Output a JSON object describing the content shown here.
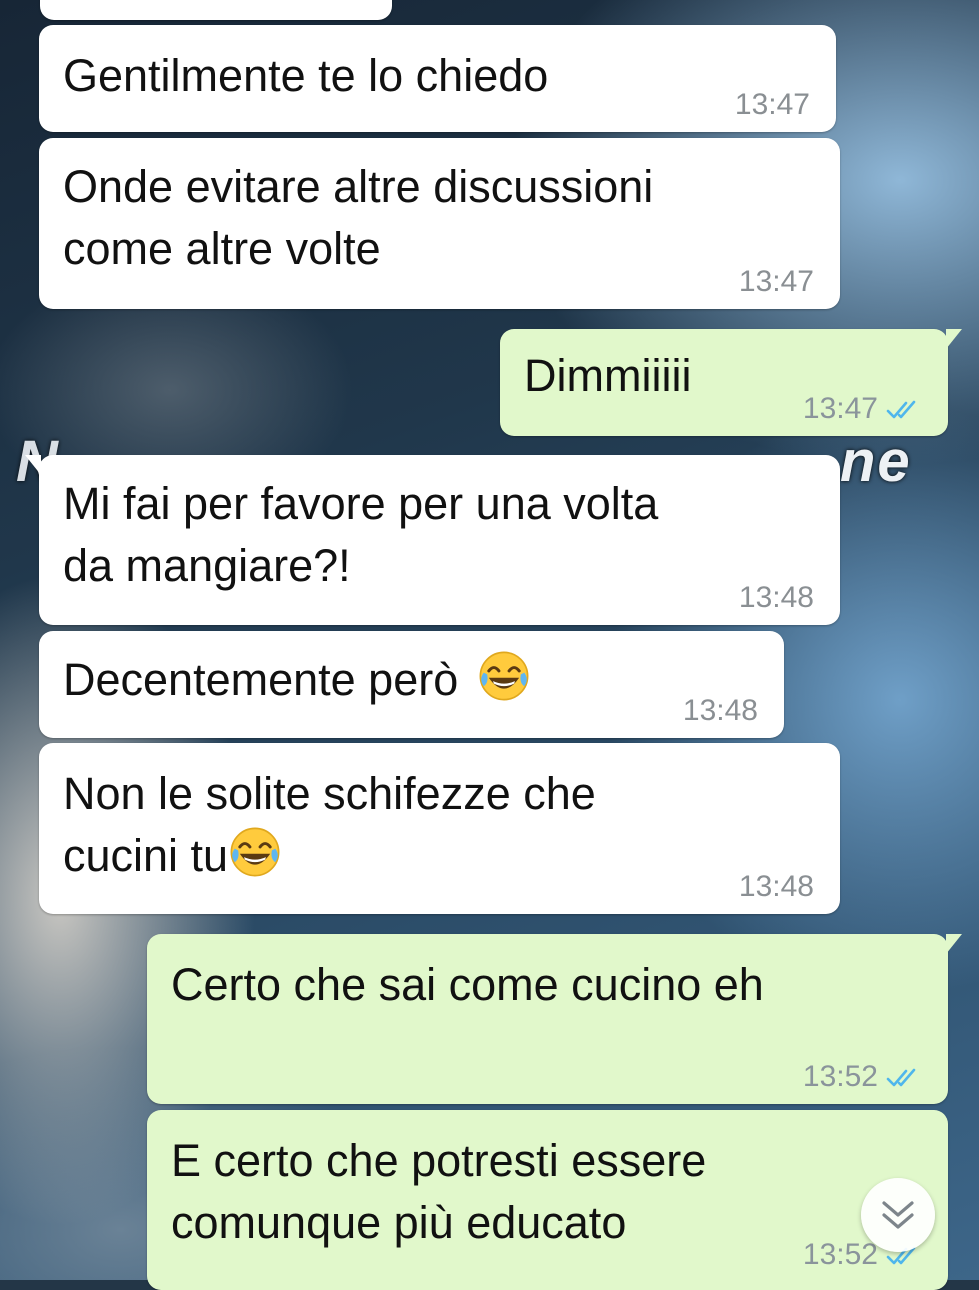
{
  "wallpaper": {
    "caption": "ne"
  },
  "messages": [
    {
      "id": "m0",
      "direction": "incoming",
      "text": "",
      "time": ""
    },
    {
      "id": "m1",
      "direction": "incoming",
      "text": "Gentilmente te lo chiedo",
      "time": "13:47"
    },
    {
      "id": "m2",
      "direction": "incoming",
      "text": "Onde evitare altre discussioni\ncome altre volte",
      "time": "13:47"
    },
    {
      "id": "m3",
      "direction": "outgoing",
      "text": "Dimmiiiii",
      "time": "13:47",
      "status": "read"
    },
    {
      "id": "m4",
      "direction": "incoming",
      "text": "Mi fai per favore per una volta\nda mangiare?!",
      "time": "13:48"
    },
    {
      "id": "m5",
      "direction": "incoming",
      "text": "Decentemente però",
      "emoji": "face-with-tears-of-joy",
      "time": "13:48"
    },
    {
      "id": "m6",
      "direction": "incoming",
      "text": "Non le solite schifezze che\ncucini tu",
      "emoji": "face-with-tears-of-joy",
      "time": "13:48"
    },
    {
      "id": "m7",
      "direction": "outgoing",
      "text": "Certo che sai come cucino eh",
      "time": "13:52",
      "status": "read"
    },
    {
      "id": "m8",
      "direction": "outgoing",
      "text": "E certo che potresti essere\ncomunque più educato",
      "time": "13:52",
      "status": "read"
    }
  ],
  "colors": {
    "incoming_bubble": "#ffffff",
    "outgoing_bubble": "#e1f8cb",
    "read_ticks": "#4fb6ec",
    "timestamp": "#8a8f93"
  },
  "icons": {
    "read_receipt": "double-check-icon",
    "scroll_down": "chevron-double-down-icon",
    "emoji": "face-with-tears-of-joy-icon"
  }
}
